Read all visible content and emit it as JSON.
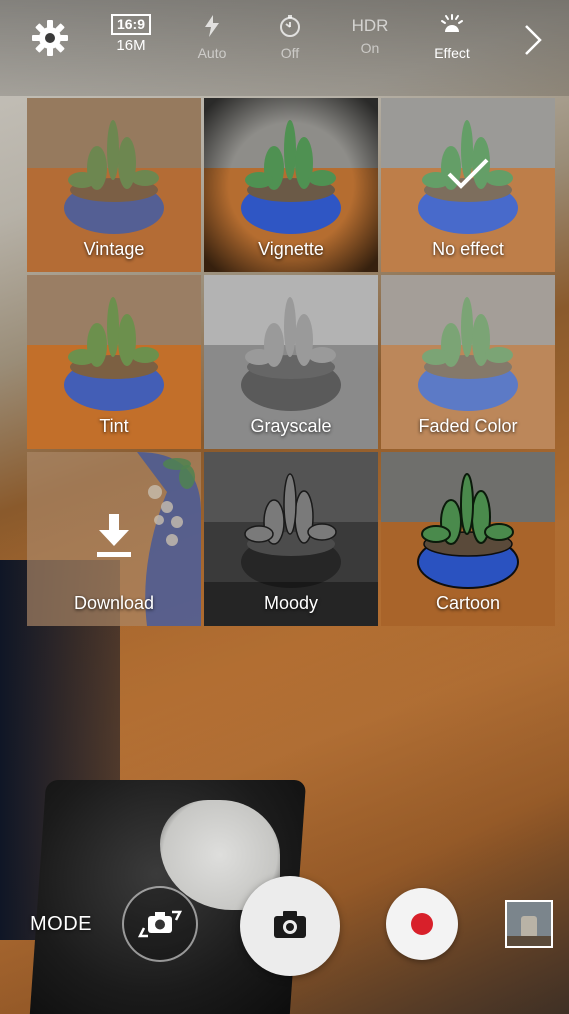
{
  "toolbar": {
    "ratio_top": "16:9",
    "ratio_bottom": "16M",
    "flash_label": "Auto",
    "timer_label": "Off",
    "hdr_top": "HDR",
    "hdr_bottom": "On",
    "effect_label": "Effect"
  },
  "effects": [
    {
      "label": "Vintage"
    },
    {
      "label": "Vignette"
    },
    {
      "label": "No effect"
    },
    {
      "label": "Tint"
    },
    {
      "label": "Grayscale"
    },
    {
      "label": "Faded Color"
    },
    {
      "label": "Download"
    },
    {
      "label": "Moody"
    },
    {
      "label": "Cartoon"
    }
  ],
  "selected_effect": "No effect",
  "bottom": {
    "mode_label": "MODE"
  },
  "colors": {
    "record_dot": "#d8202a",
    "shutter_bg": "#ececec",
    "selected_outline": "#ffffff"
  },
  "icons": {
    "settings": "gear-icon",
    "flash": "flash-auto-icon",
    "timer": "timer-icon",
    "effect": "effect-sun-icon",
    "more": "chevron-right-icon",
    "download": "download-icon",
    "switch_camera": "switch-camera-icon",
    "shutter": "camera-icon",
    "record": "record-icon",
    "selected": "checkmark-icon"
  }
}
